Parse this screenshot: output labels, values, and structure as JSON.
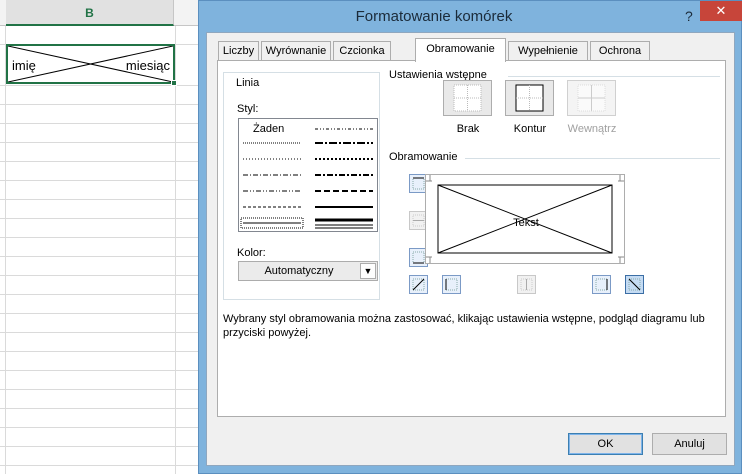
{
  "sheet": {
    "column_header": "B",
    "cell_left_text": "imię",
    "cell_right_text": "miesiąc"
  },
  "dialog": {
    "title": "Formatowanie komórek",
    "help": "?",
    "close": "✕",
    "tabs": [
      {
        "label": "Liczby"
      },
      {
        "label": "Wyrównanie"
      },
      {
        "label": "Czcionka"
      },
      {
        "label": "Obramowanie",
        "active": true
      },
      {
        "label": "Wypełnienie"
      },
      {
        "label": "Ochrona"
      }
    ],
    "line_group": {
      "title": "Linia",
      "style_label": "Styl:",
      "none_option": "Żaden",
      "color_label": "Kolor:",
      "color_value": "Automatyczny"
    },
    "presets": {
      "title": "Ustawienia wstępne",
      "items": [
        {
          "label": "Brak"
        },
        {
          "label": "Kontur"
        },
        {
          "label": "Wewnątrz",
          "disabled": true
        }
      ]
    },
    "border": {
      "title": "Obramowanie",
      "preview_text": "Tekst"
    },
    "hint": "Wybrany styl obramowania można zastosować, klikając ustawienia wstępne, podgląd diagramu lub przyciski powyżej.",
    "ok_label": "OK",
    "cancel_label": "Anuluj"
  },
  "colors": {
    "excel_green": "#217346",
    "dialog_frame": "#7fb3dd",
    "close_red": "#c7453a"
  }
}
